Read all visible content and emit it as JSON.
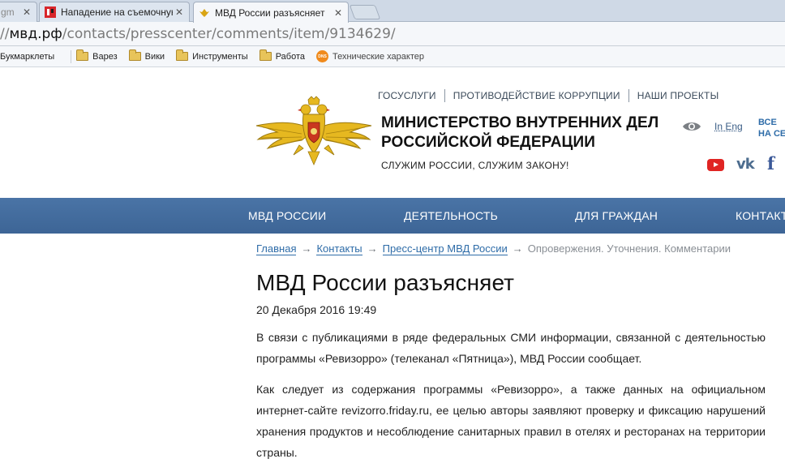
{
  "browser": {
    "tabs": [
      {
        "title": "gm",
        "active": false
      },
      {
        "title": "Нападение на съемочную г",
        "active": false
      },
      {
        "title": "МВД России разъясняет",
        "active": true
      }
    ],
    "close_glyph": "✕",
    "url": {
      "prefix": "//",
      "host": "мвд.рф",
      "path": "/contacts/presscenter/comments/item/9134629/"
    },
    "bookmarks": [
      {
        "label": "Букмарклеты",
        "icon": "none"
      },
      {
        "label": "Варез",
        "icon": "folder-icon"
      },
      {
        "label": "Вики",
        "icon": "folder-icon"
      },
      {
        "label": "Инструменты",
        "icon": "folder-icon"
      },
      {
        "label": "Работа",
        "icon": "folder-icon"
      },
      {
        "label": "Технические характер",
        "icon": "dns-icon"
      }
    ],
    "dns_badge": "DNS"
  },
  "site": {
    "top_nav": [
      "ГОСУСЛУГИ",
      "ПРОТИВОДЕЙСТВИЕ КОРРУПЦИИ",
      "НАШИ ПРОЕКТЫ"
    ],
    "ministry_line1": "МИНИСТЕРСТВО ВНУТРЕННИХ ДЕЛ",
    "ministry_line2": "РОССИЙСКОЙ ФЕДЕРАЦИИ",
    "motto": "СЛУЖИМ РОССИИ, СЛУЖИМ ЗАКОНУ!",
    "lang_link": "In Eng",
    "all_services_line1": "ВСЕ",
    "all_services_line2": "НА СЕ",
    "vk_label": "vk",
    "fb_label": "f",
    "main_nav": [
      "МВД РОССИИ",
      "ДЕЯТЕЛЬНОСТЬ",
      "ДЛЯ ГРАЖДАН",
      "КОНТАКТ"
    ],
    "colors": {
      "nav_bar": "#4a74a6",
      "link": "#2e6ca8",
      "youtube": "#e02523",
      "vk": "#4d6d8f",
      "facebook": "#3b5998",
      "emblem_gold": "#e6b820"
    }
  },
  "breadcrumb": {
    "items": [
      "Главная",
      "Контакты",
      "Пресс-центр МВД России"
    ],
    "current": "Опровержения. Уточнения. Комментарии",
    "separator": "→"
  },
  "article": {
    "title": "МВД России разъясняет",
    "date": "20 Декабря 2016 19:49",
    "paragraphs": [
      "В связи с публикациями в ряде федеральных СМИ информации, связанной с деятельностью программы «Ревизорро» (телеканал «Пятница»), МВД России сообщает.",
      "Как следует из содержания программы «Ревизорро», а также данных на официальном интернет-сайте revizorro.friday.ru, ее целью авторы заявляют проверку и фиксацию нарушений хранения продуктов и несоблюдение санитарных правил в отелях и ресторанах на территории страны."
    ]
  }
}
